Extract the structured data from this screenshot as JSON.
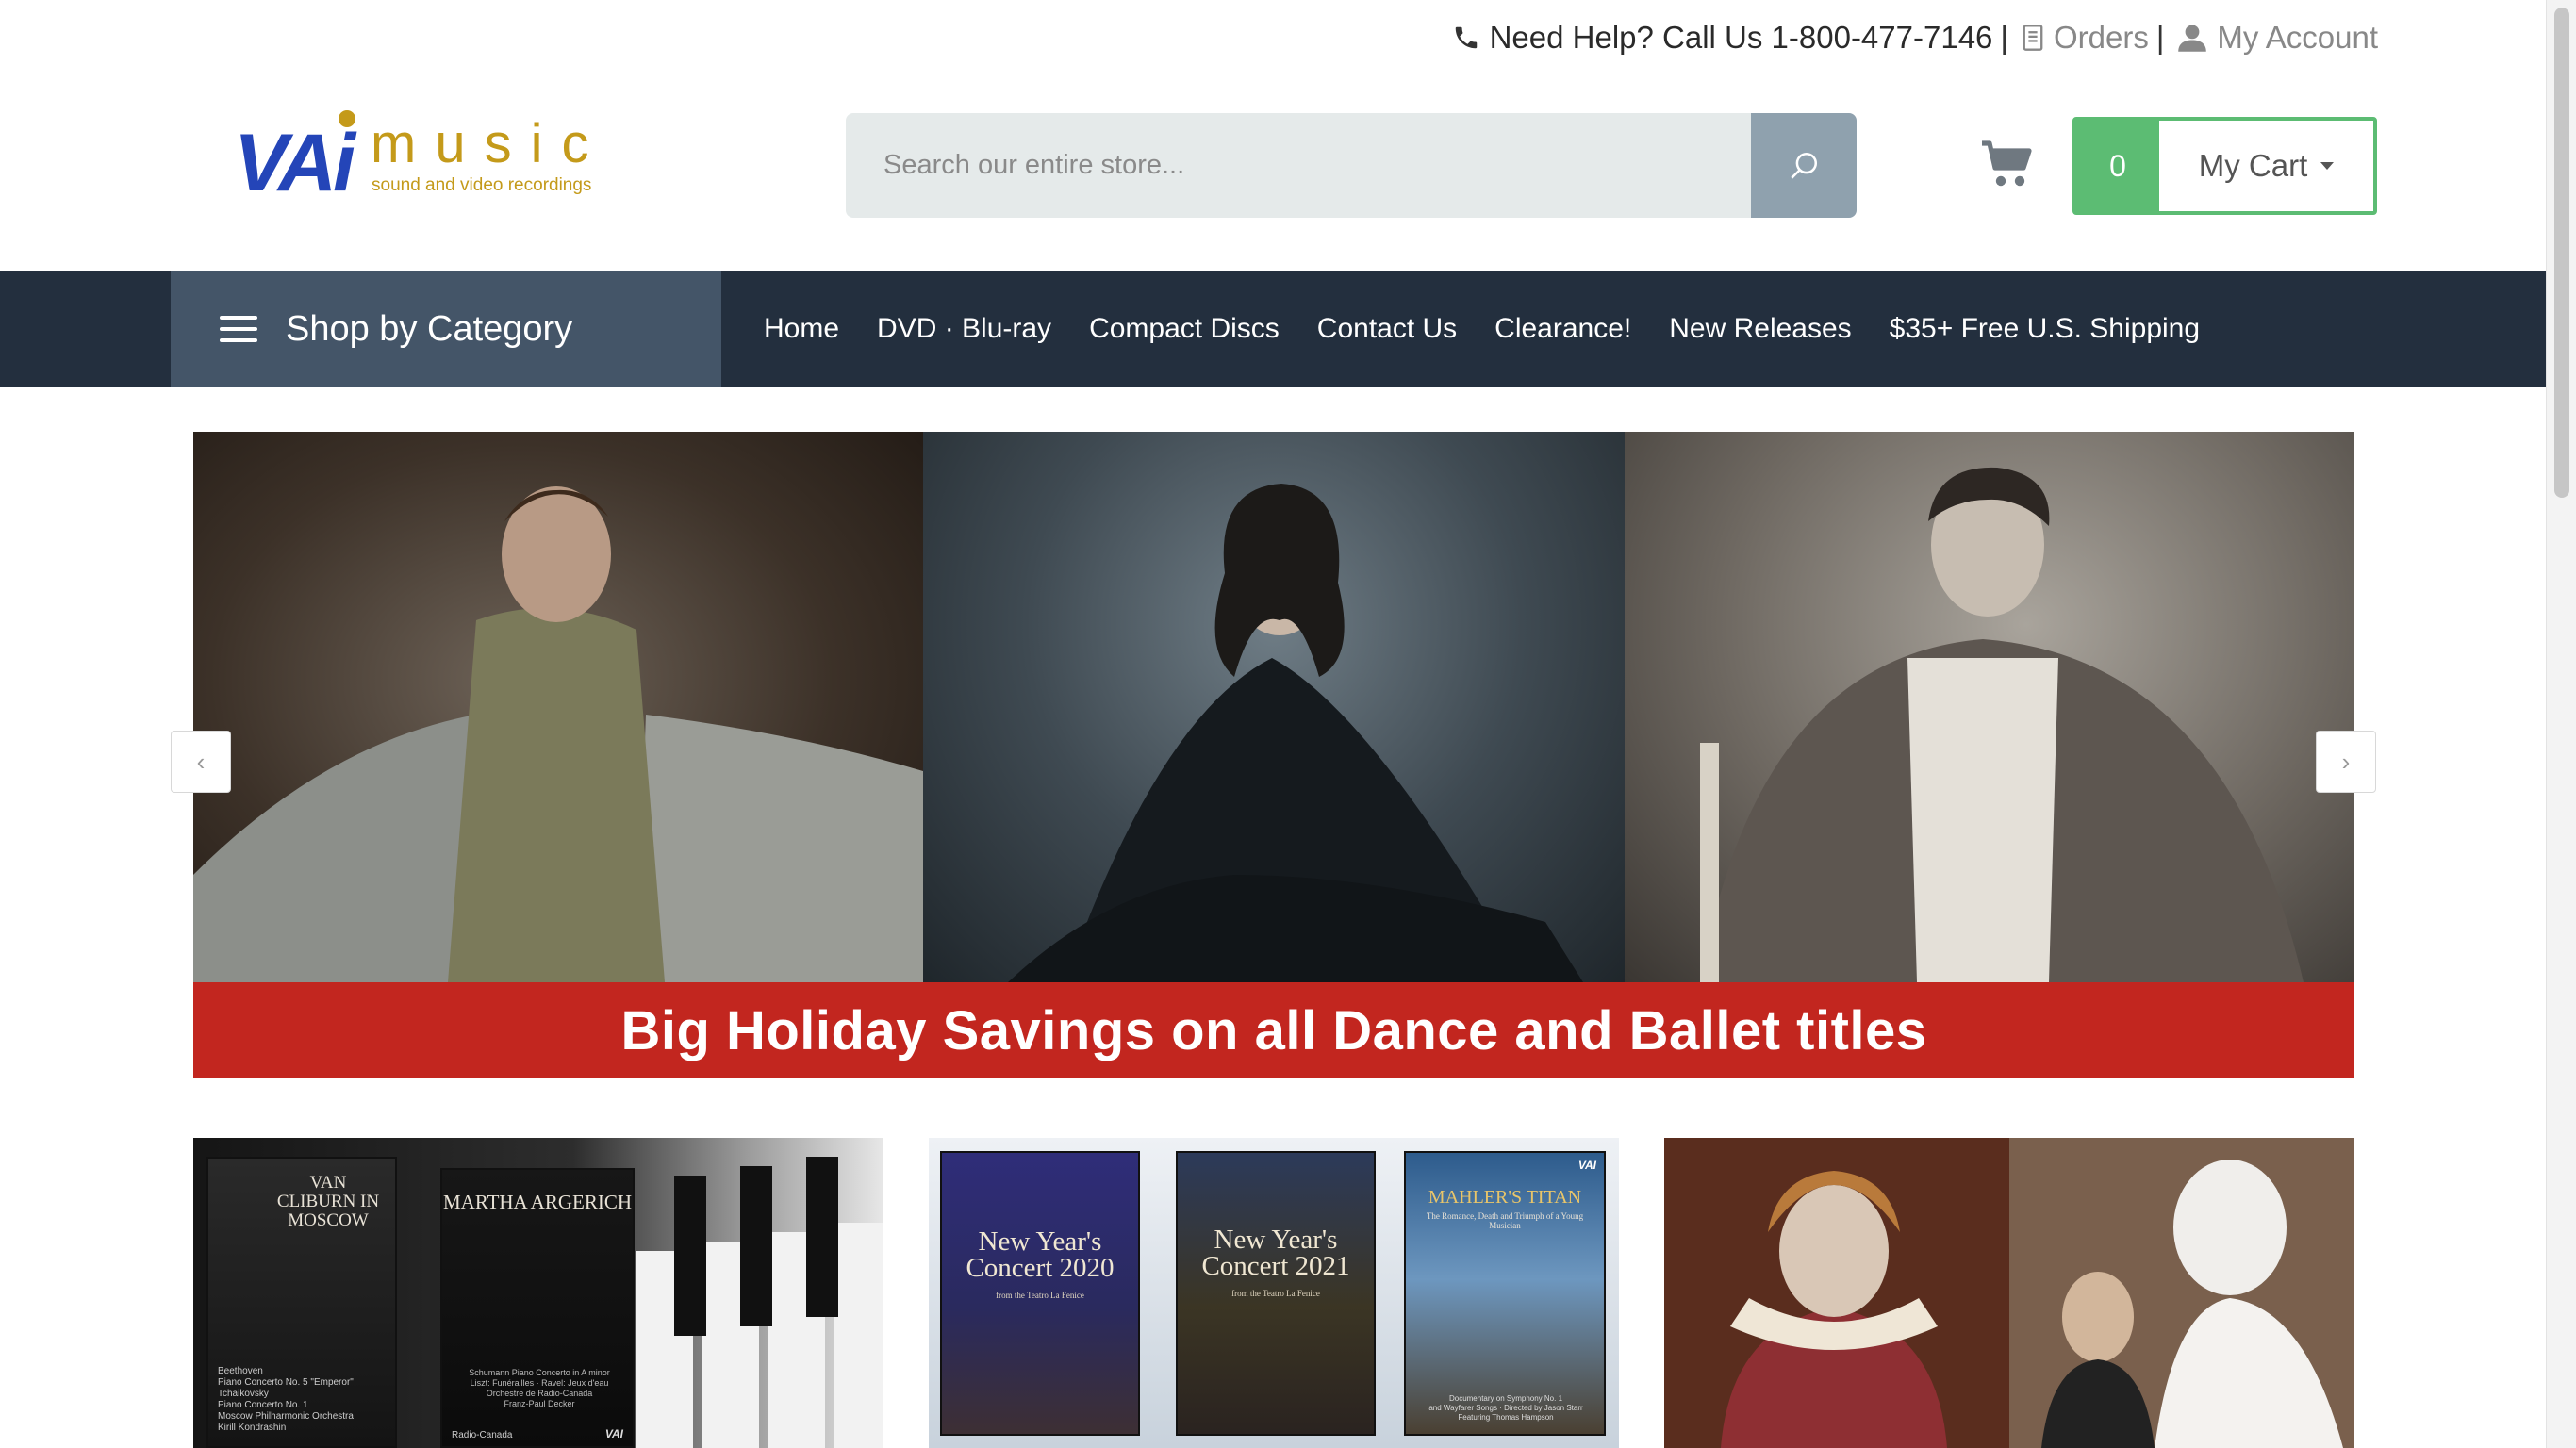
{
  "topbar": {
    "help_text": "Need Help? Call Us 1-800-477-7146",
    "separator": "|",
    "orders_label": "Orders",
    "account_label": "My Account"
  },
  "logo": {
    "brand_main": "VAi",
    "brand_word": "music",
    "tagline": "sound and video recordings"
  },
  "search": {
    "placeholder": "Search our entire store..."
  },
  "cart": {
    "count": "0",
    "label": "My Cart"
  },
  "nav": {
    "category_button": "Shop by Category",
    "links": [
      "Home",
      "DVD · Blu-ray",
      "Compact Discs",
      "Contact Us",
      "Clearance!",
      "New Releases",
      "$35+ Free U.S. Shipping"
    ]
  },
  "hero": {
    "banner_text": "Big Holiday Savings on all Dance and Ballet titles"
  },
  "tiles": {
    "t1": {
      "dvd1_title": "VAN CLIBURN IN MOSCOW",
      "dvd2_title": "MARTHA ARGERICH",
      "dvd1_credits": [
        "Beethoven",
        "Piano Concerto No. 5 \"Emperor\"",
        "Tchaikovsky",
        "Piano Concerto No. 1",
        "Moscow Philharmonic Orchestra",
        "Kirill Kondrashin"
      ],
      "dvd2_credits": [
        "Schumann Piano Concerto in A minor",
        "Liszt: Funérailles · Ravel: Jeux d'eau",
        "Orchestre de Radio-Canada",
        "Franz-Paul Decker"
      ],
      "dvd2_label": "Radio-Canada",
      "publisher_mark": "VAI"
    },
    "t2": {
      "dvd1_title": "New Year's Concert 2020",
      "dvd2_title": "New Year's Concert 2021",
      "dvd_subtitle": "from the Teatro La Fenice",
      "dvd3_title": "MAHLER'S TITAN",
      "dvd3_subtitle": "The Romance, Death and Triumph of a Young Musician",
      "dvd3_credits": [
        "Documentary on Symphony No. 1",
        "and Wayfarer Songs · Directed by Jason Starr",
        "Featuring Thomas Hampson"
      ],
      "publisher_mark": "VAI"
    }
  },
  "colors": {
    "nav_bg": "#232f3e",
    "category_bg": "#445568",
    "cart_green": "#5cbc73",
    "banner_red": "#c2261f",
    "logo_blue": "#2445b8",
    "logo_gold": "#c49a1a"
  }
}
